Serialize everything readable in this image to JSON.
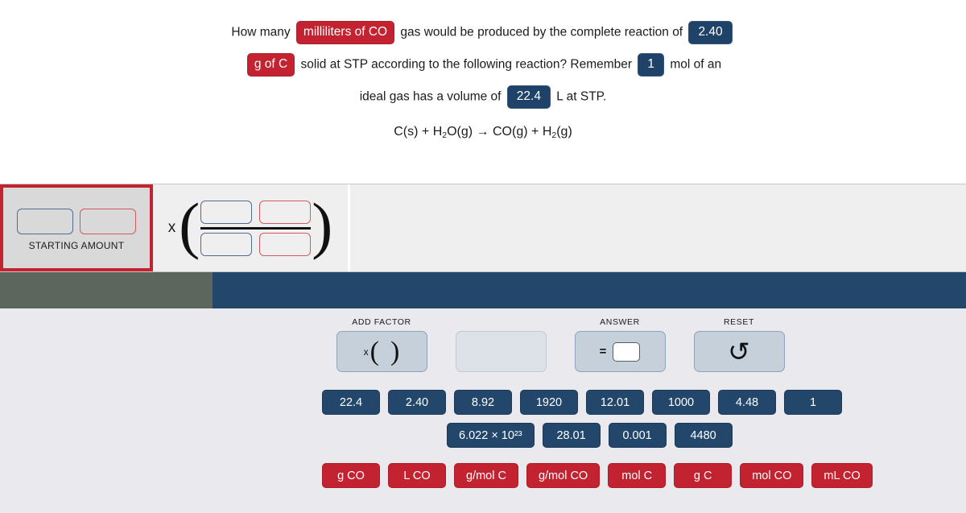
{
  "question": {
    "line1": [
      {
        "type": "text",
        "value": "How many"
      },
      {
        "type": "pill-red",
        "value": "milliliters of CO"
      },
      {
        "type": "text",
        "value": "gas would be produced by the complete reaction of"
      },
      {
        "type": "pill-navy",
        "value": "2.40"
      }
    ],
    "line1_text_a": "How many",
    "line1_pill_a": "milliliters of CO",
    "line1_text_b": "gas would be produced by the complete reaction of",
    "line1_pill_b": "2.40",
    "line2_pill_a": "g of C",
    "line2_text_a": "solid at STP according to the following reaction? Remember",
    "line2_pill_b": "1",
    "line2_text_b": "mol of an",
    "line3_text_a": "ideal gas has a volume of",
    "line3_pill_a": "22.4",
    "line3_text_b": "L at STP.",
    "equation": {
      "reactant1": "C(s)",
      "plus1": "+",
      "reactant2_a": "H",
      "reactant2_sub": "2",
      "reactant2_b": "O(g)",
      "arrow": "→",
      "product1": "CO(g)",
      "plus2": "+",
      "product2_a": "H",
      "product2_sub": "2",
      "product2_b": "(g)",
      "full": "C(s) + H2O(g) → CO(g) + H2(g)"
    }
  },
  "work_area": {
    "starting_amount_label": "STARTING AMOUNT",
    "multiply_symbol": "x",
    "open_paren": "(",
    "close_paren": ")",
    "starting_slots": [
      {
        "name": "value-slot",
        "color": "#4f6f8f",
        "value": ""
      },
      {
        "name": "unit-slot",
        "color": "#d2595f",
        "value": ""
      }
    ],
    "factor_slots": {
      "numerator": [
        {
          "name": "value-slot",
          "color": "#4f6f8f",
          "value": ""
        },
        {
          "name": "unit-slot",
          "color": "#d2595f",
          "value": ""
        }
      ],
      "denominator": [
        {
          "name": "value-slot",
          "color": "#4f6f8f",
          "value": ""
        },
        {
          "name": "unit-slot",
          "color": "#d2595f",
          "value": ""
        }
      ]
    }
  },
  "bars": {
    "olive_color": "#5c665c",
    "navy_color": "#23466b"
  },
  "toolbar": [
    {
      "label": "ADD FACTOR",
      "glyph": "x( )",
      "name": "add-factor"
    },
    {
      "label": "",
      "glyph": "",
      "name": "blank"
    },
    {
      "label": "ANSWER",
      "glyph": "=",
      "name": "answer"
    },
    {
      "label": "RESET",
      "glyph": "↺",
      "name": "reset"
    }
  ],
  "toolbar_labels": {
    "add_factor": "ADD FACTOR",
    "blank": "",
    "answer": "ANSWER",
    "reset": "RESET"
  },
  "toolbar_glyphs": {
    "multiply": "x",
    "open_paren": "(",
    "close_paren": ")",
    "equals": "=",
    "undo": "↺"
  },
  "tiles": {
    "numeric_row1": [
      "22.4",
      "2.40",
      "8.92",
      "1920",
      "12.01",
      "1000",
      "4.48",
      "1"
    ],
    "numeric_row2": [
      "6.022 × 10²³",
      "28.01",
      "0.001",
      "4480"
    ],
    "units_row": [
      "g CO",
      "L CO",
      "g/mol C",
      "g/mol CO",
      "mol C",
      "g C",
      "mol CO",
      "mL CO"
    ]
  },
  "colors": {
    "accent_red": "#c32230",
    "accent_navy": "#23466b",
    "pill_navy": "#1e4268",
    "work_bg": "#efeff0",
    "tray_bg": "#e9e9ee",
    "starting_bg": "#d9d9d9",
    "tool_btn": "#c5d0da"
  }
}
